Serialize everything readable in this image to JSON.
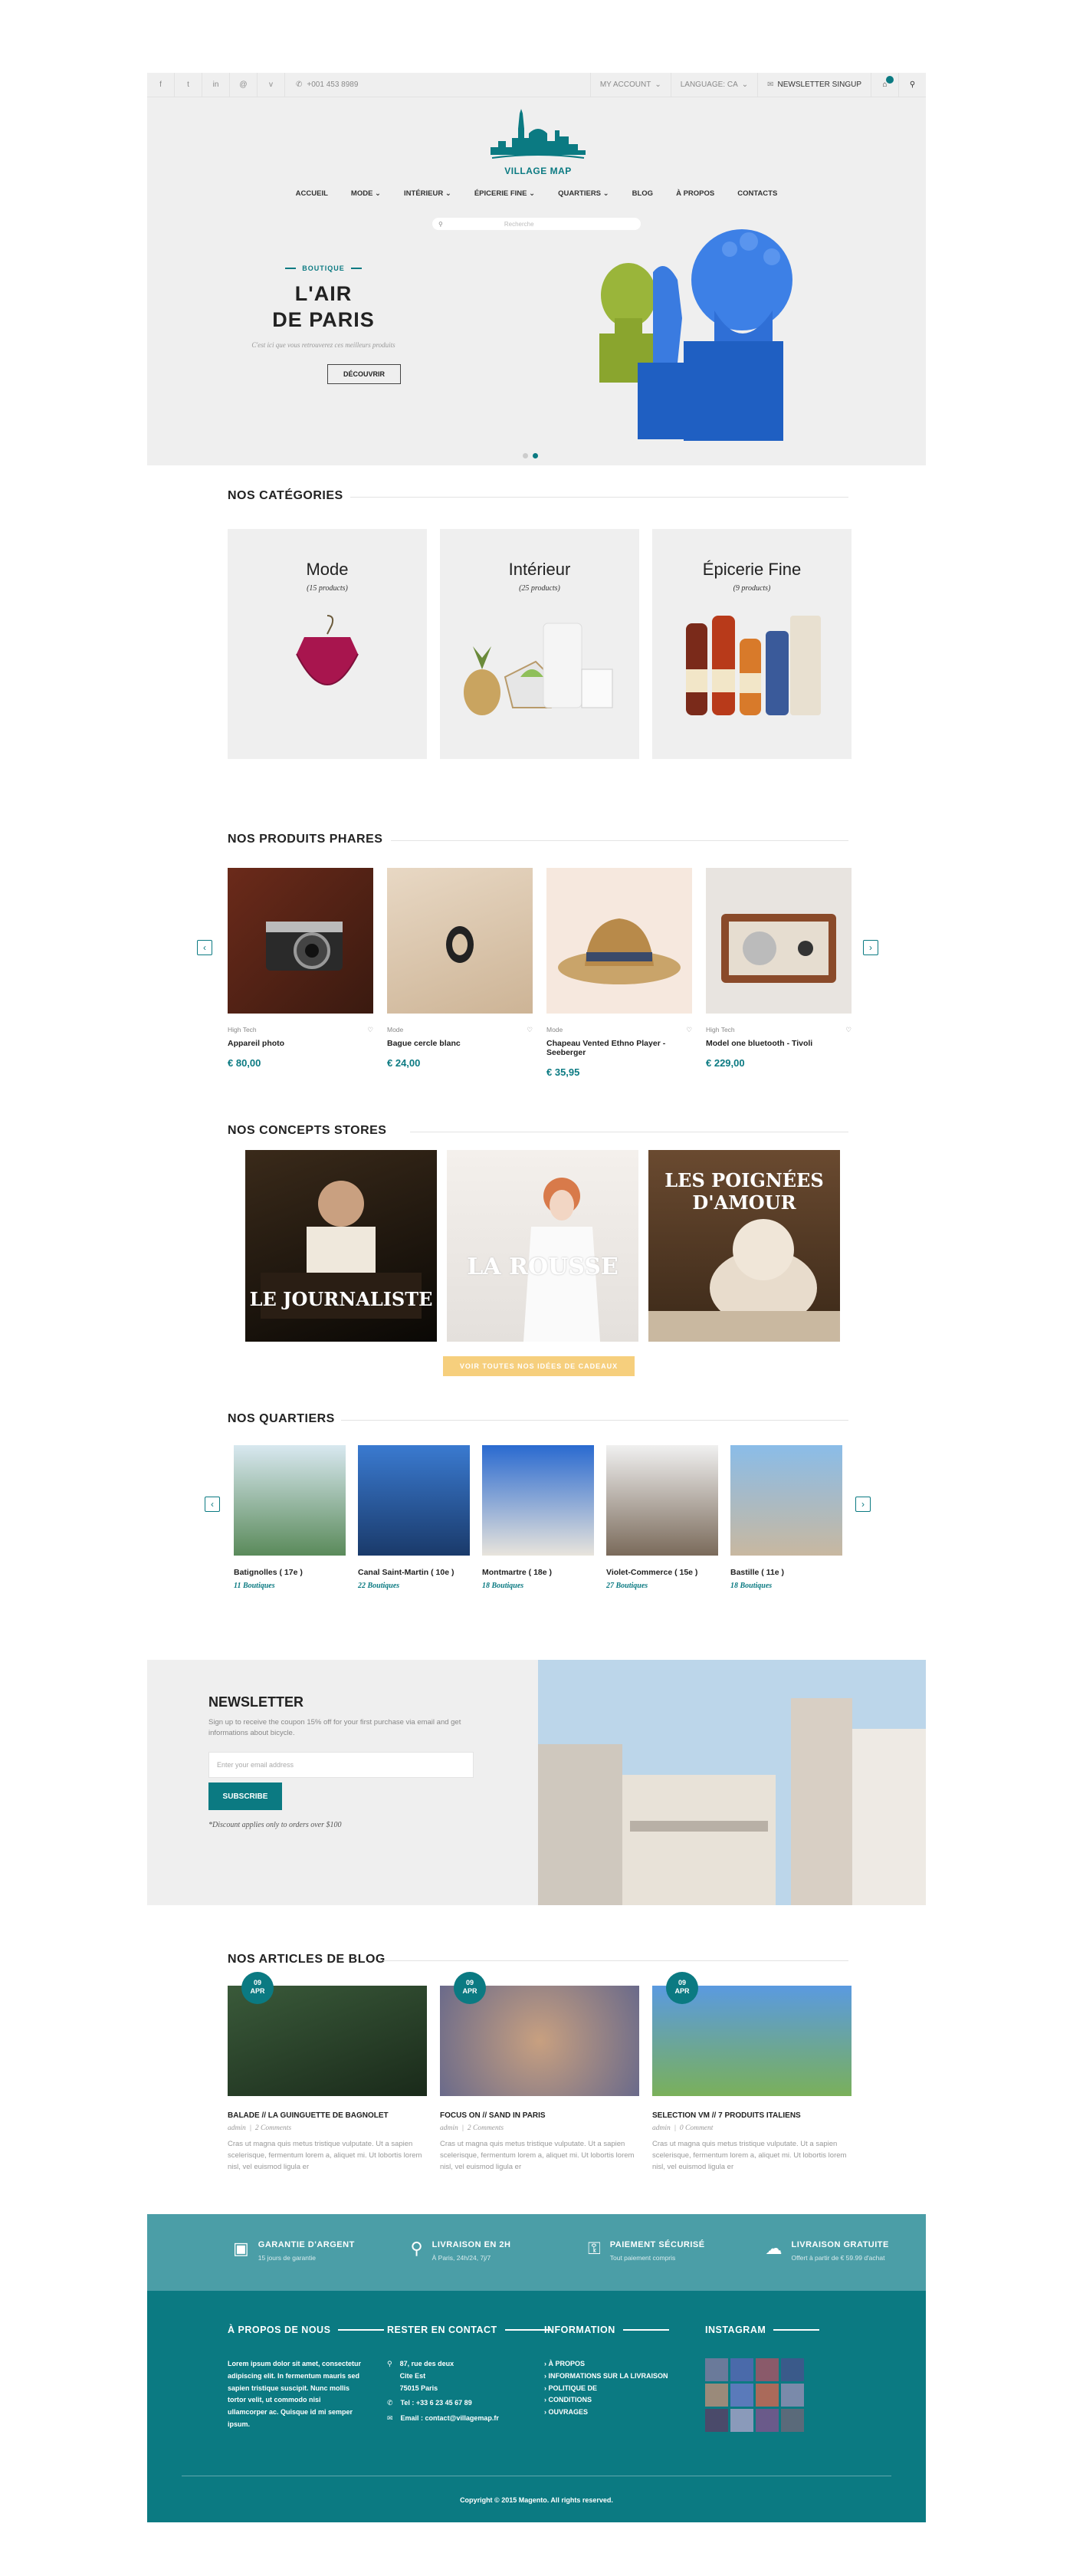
{
  "topbar": {
    "phone": "+001 453 8989",
    "account": "MY ACCOUNT",
    "language": "LANGUAGE: CA",
    "newsletter": "NEWSLETTER SINGUP",
    "social": [
      "f",
      "t",
      "in",
      "@",
      "v"
    ]
  },
  "brand": {
    "logo_text": "VILLAGE MAP"
  },
  "nav": [
    "ACCUEIL",
    "MODE",
    "INTÉRIEUR",
    "ÉPICERIE FINE",
    "QUARTIERS",
    "BLOG",
    "À PROPOS",
    "CONTACTS"
  ],
  "search": {
    "placeholder": "Recherche"
  },
  "hero": {
    "kicker": "BOUTIQUE",
    "title_1": "L'AIR",
    "title_2": "DE PARIS",
    "subtitle": "C'est ici que vous retrouverez ces meilleurs produits",
    "button": "DÉCOUVRIR"
  },
  "categories": {
    "title": "NOS CATÉGORIES",
    "items": [
      {
        "name": "Mode",
        "count": "(15 products)"
      },
      {
        "name": "Intérieur",
        "count": "(25 products)"
      },
      {
        "name": "Épicerie Fine",
        "count": "(9 products)"
      }
    ]
  },
  "products": {
    "title": "NOS  PRODUITS  PHARES",
    "items": [
      {
        "cat": "High Tech",
        "name": "Appareil photo",
        "price": "€ 80,00"
      },
      {
        "cat": "Mode",
        "name": "Bague cercle blanc",
        "price": "€ 24,00"
      },
      {
        "cat": "Mode",
        "name": "Chapeau Vented Ethno Player - Seeberger",
        "price": "€ 35,95"
      },
      {
        "cat": "High Tech",
        "name": "Model one bluetooth - Tivoli",
        "price": "€ 229,00"
      }
    ]
  },
  "stores": {
    "title": "NOS CONCEPTS STORES",
    "items": [
      "LE JOURNALISTE",
      "LA ROUSSE",
      "LES POIGNÉES D'AMOUR"
    ],
    "cta": "VOIR TOUTES NOS IDÉES DE CADEAUX"
  },
  "quartiers": {
    "title": "NOS QUARTIERS",
    "items": [
      {
        "name": "Batignolles ( 17e )",
        "count": "11 Boutiques"
      },
      {
        "name": "Canal Saint-Martin ( 10e )",
        "count": "22 Boutiques"
      },
      {
        "name": "Montmartre ( 18e )",
        "count": "18 Boutiques"
      },
      {
        "name": "Violet-Commerce ( 15e )",
        "count": "27 Boutiques"
      },
      {
        "name": "Bastille ( 11e )",
        "count": "18 Boutiques"
      }
    ]
  },
  "newsletter": {
    "title": "NEWSLETTER",
    "text": "Sign up to receive the coupon 15% off for your first purchase via email and get informations about bicycle.",
    "placeholder": "Enter your email address",
    "button": "SUBSCRIBE",
    "note": "*Discount applies only to orders over $100"
  },
  "blog": {
    "title": "NOS ARTICLES DE BLOG",
    "items": [
      {
        "day": "09",
        "month": "APR",
        "title": "BALADE // LA GUINGUETTE DE BAGNOLET",
        "author": "admin",
        "comments": "2 Comments",
        "text": "Cras ut magna quis metus tristique vulputate. Ut a sapien scelerisque, fermentum lorem a, aliquet mi. Ut lobortis lorem nisl, vel euismod ligula er"
      },
      {
        "day": "09",
        "month": "APR",
        "title": "FOCUS ON // SAND IN PARIS",
        "author": "admin",
        "comments": "2 Comments",
        "text": "Cras ut magna quis metus tristique vulputate. Ut a sapien scelerisque, fermentum lorem a, aliquet mi. Ut lobortis lorem nisl, vel euismod ligula er"
      },
      {
        "day": "09",
        "month": "APR",
        "title": "SELECTION VM // 7 PRODUITS ITALIENS",
        "author": "admin",
        "comments": "0 Comment",
        "text": "Cras ut magna quis metus tristique vulputate. Ut a sapien scelerisque, fermentum lorem a, aliquet mi. Ut lobortis lorem nisl, vel euismod ligula er"
      }
    ]
  },
  "features": [
    {
      "title": "GARANTIE D'ARGENT",
      "sub": "15 jours de garantie"
    },
    {
      "title": "LIVRAISON EN 2H",
      "sub": "À Paris, 24h/24, 7j/7"
    },
    {
      "title": "PAIEMENT SÉCURISÉ",
      "sub": "Tout paiement compris"
    },
    {
      "title": "LIVRAISON GRATUITE",
      "sub": "Offert à partir de € 59.99 d'achat"
    }
  ],
  "footer": {
    "about_title": "À PROPOS DE NOUS",
    "about_text": "Lorem ipsum dolor sit amet, consectetur adipiscing elit. In fermentum mauris sed sapien tristique suscipit. Nunc mollis tortor velit, ut commodo nisi ullamcorper ac. Quisque id mi semper ipsum.",
    "contact_title": "RESTER EN CONTACT",
    "address_1": "87, rue des deux",
    "address_2": "Cite Est",
    "address_3": "75015 Paris",
    "tel": "Tel : +33 6 23 45 67 89",
    "email": "Email : contact@villagemap.fr",
    "info_title": "INFORMATION",
    "info_links": [
      "À PROPOS",
      "INFORMATIONS SUR LA LIVRAISON",
      "POLITIQUE DE",
      "CONDITIONS",
      "OUVRAGES"
    ],
    "instagram_title": "INSTAGRAM",
    "copyright": "Copyright © 2015 Magento. All rights reserved."
  },
  "colors": {
    "accent": "#0b7a82",
    "feature_bar": "#4b9ea7",
    "cta": "#f6cf7d"
  }
}
